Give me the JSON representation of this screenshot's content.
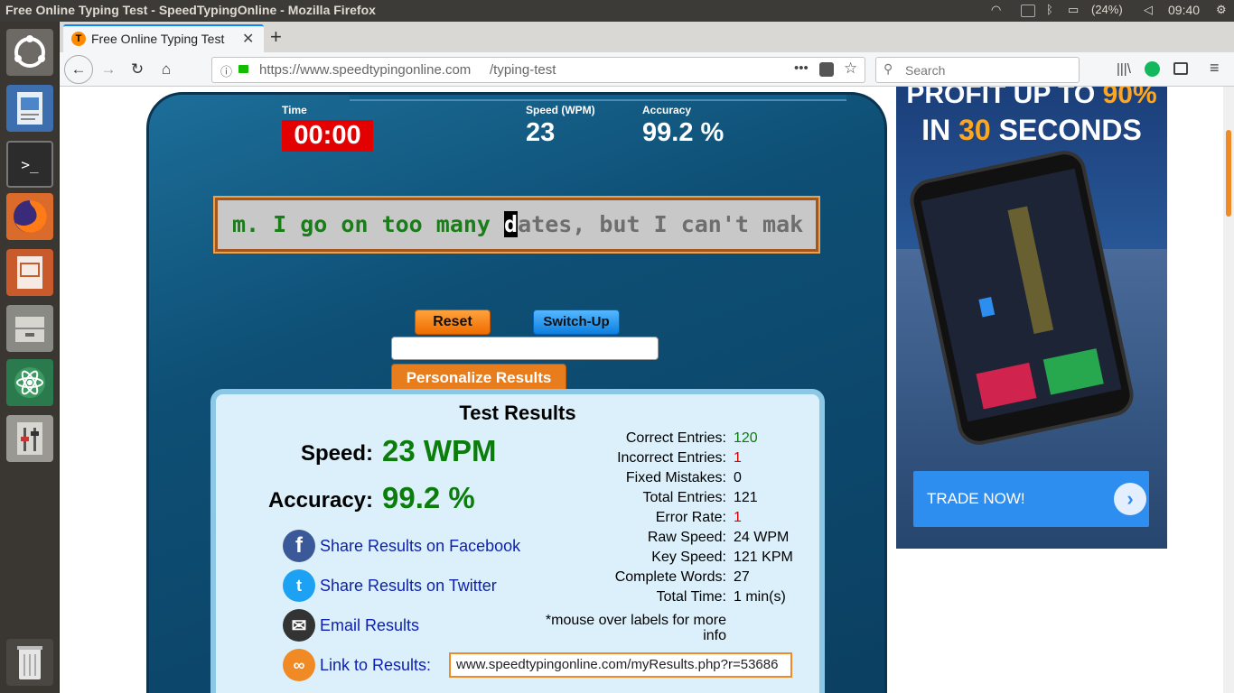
{
  "window": {
    "title": "Free Online Typing Test - SpeedTypingOnline - Mozilla Firefox"
  },
  "system": {
    "battery": "(24%)",
    "clock": "09:40"
  },
  "browser": {
    "tab_title": "Free Online Typing Test",
    "url_host": "https://www.speedtypingonline.com",
    "url_path": "/typing-test",
    "search_placeholder": "Search",
    "more_icon": "•••"
  },
  "test": {
    "time_label": "Time",
    "time_value": "00:00",
    "speed_label": "Speed (WPM)",
    "speed_value": "23",
    "accuracy_label": "Accuracy",
    "accuracy_value": "99.2 %",
    "text_done": "m. I go on too many ",
    "text_cursor": "d",
    "text_todo": "ates, but I can't mak",
    "reset_label": "Reset",
    "switchup_label": "Switch-Up",
    "name_value": "",
    "personalize_label": "Personalize Results"
  },
  "results": {
    "title": "Test Results",
    "speed_label": "Speed:",
    "speed_value": "23 WPM",
    "accuracy_label": "Accuracy:",
    "accuracy_value": "99.2 %",
    "share_facebook": "Share Results on Facebook",
    "share_twitter": "Share Results on Twitter",
    "email": "Email Results",
    "link_label": "Link to Results:",
    "link_value": "www.speedtypingonline.com/myResults.php?r=53686",
    "details": [
      {
        "label": "Correct Entries:",
        "value": "120",
        "color": "#0b7d0b"
      },
      {
        "label": "Incorrect Entries:",
        "value": "1",
        "color": "#d40000"
      },
      {
        "label": "Fixed Mistakes:",
        "value": "0",
        "color": "#000000"
      },
      {
        "label": "Total Entries:",
        "value": "121",
        "color": "#000000"
      },
      {
        "label": "Error Rate:",
        "value": "1",
        "color": "#d40000"
      },
      {
        "label": "Raw Speed:",
        "value": "24 WPM",
        "color": "#000000"
      },
      {
        "label": "Key Speed:",
        "value": "121 KPM",
        "color": "#000000"
      },
      {
        "label": "Complete Words:",
        "value": "27",
        "color": "#000000"
      },
      {
        "label": "Total Time:",
        "value": "1 min(s)",
        "color": "#000000"
      }
    ],
    "note": "*mouse over labels for more info"
  },
  "ad": {
    "line1_prefix": "PROFIT UP TO ",
    "line1_highlight": "90%",
    "line2_prefix": "IN ",
    "line2_highlight": "30",
    "line2_suffix": " SECONDS",
    "cta": "TRADE NOW!"
  },
  "colors": {
    "accent": "#f08a24",
    "panel": "#0e4f75",
    "results_bg": "#dcf0fb",
    "good": "#0b7d0b",
    "bad": "#d40000"
  }
}
